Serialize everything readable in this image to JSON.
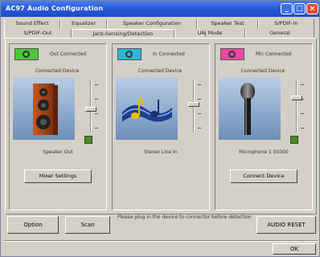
{
  "window": {
    "title": "AC97 Audio Configuration"
  },
  "tabs": {
    "back_row": [
      "Sound Effect",
      "Equalizer",
      "Speaker Configuration",
      "Speaker Test",
      "S/PDIF-In"
    ],
    "front_row": [
      "S/PDIF-Out",
      "Jack-Sensing/Detection",
      "UAJ Mode",
      "General"
    ],
    "active": "Jack-Sensing/Detection"
  },
  "panels": [
    {
      "jack_color": "#4cc838",
      "jack_label": "Out Connected",
      "setting": "Connected Device",
      "device_name": "Speaker Out",
      "button": "Mixer Settings"
    },
    {
      "jack_color": "#28b8d8",
      "jack_label": "In Connected",
      "setting": "Connected Device",
      "device_name": "Stereo Line In",
      "button": ""
    },
    {
      "jack_color": "#ee48a8",
      "jack_label": "Mic Connected",
      "setting": "Connected Device",
      "device_name": "Microphone 1 SS000",
      "button": "Connect Device"
    }
  ],
  "footer": {
    "option_button": "Option",
    "scan_button": "Scan",
    "hint": "Please plug in the device to connector before detection",
    "brand_button": "AUDIO RESET",
    "ok_button": "OK"
  },
  "colors": {
    "title_bar": "#2a5ad8",
    "dialog_bg": "#d4d0c8"
  },
  "icons": {
    "panel_1": "speaker-cabinet-image",
    "panel_2": "music-notes-image",
    "panel_3": "microphone-image"
  }
}
